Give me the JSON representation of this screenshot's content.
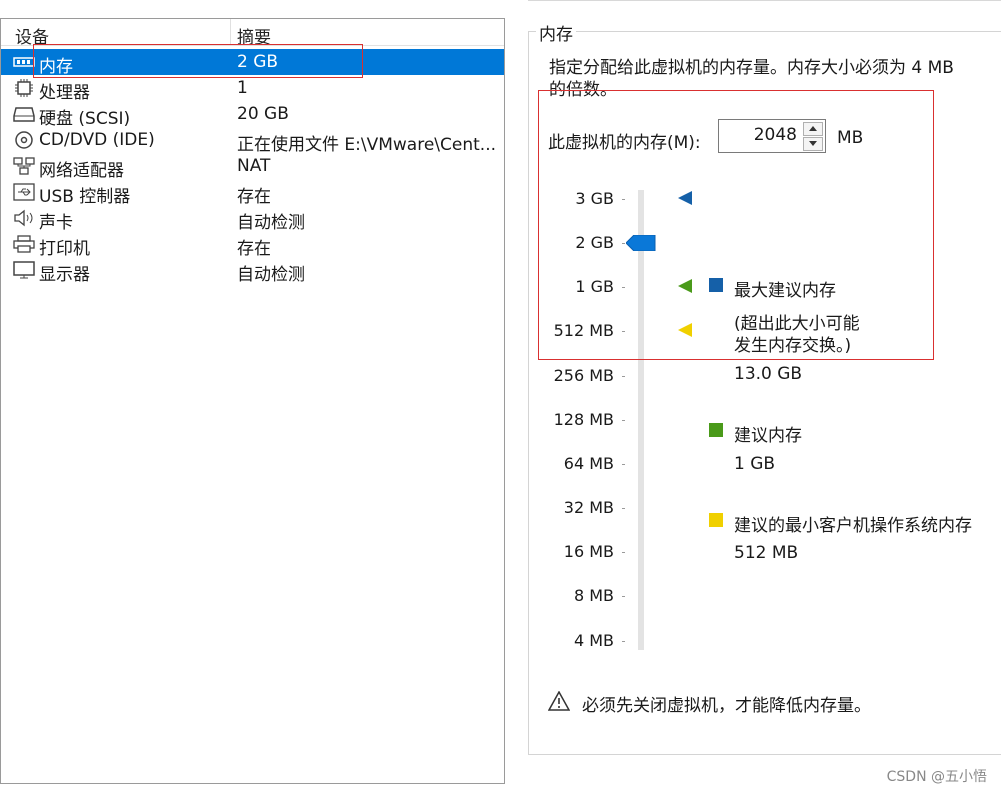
{
  "table": {
    "col_device": "设备",
    "col_summary": "摘要"
  },
  "devices": [
    {
      "name": "内存",
      "summary": "2 GB",
      "icon": "memory-icon"
    },
    {
      "name": "处理器",
      "summary": "1",
      "icon": "processor-icon"
    },
    {
      "name": "硬盘 (SCSI)",
      "summary": "20 GB",
      "icon": "harddisk-icon"
    },
    {
      "name": "CD/DVD (IDE)",
      "summary": "正在使用文件 E:\\VMware\\Cent...",
      "icon": "cd-dvd-icon"
    },
    {
      "name": "网络适配器",
      "summary": "NAT",
      "icon": "network-adapter-icon"
    },
    {
      "name": "USB 控制器",
      "summary": "存在",
      "icon": "usb-icon"
    },
    {
      "name": "声卡",
      "summary": "自动检测",
      "icon": "sound-card-icon"
    },
    {
      "name": "打印机",
      "summary": "存在",
      "icon": "printer-icon"
    },
    {
      "name": "显示器",
      "summary": "自动检测",
      "icon": "monitor-icon"
    }
  ],
  "memory": {
    "group_title": "内存",
    "description_line1": "指定分配给此虚拟机的内存量。内存大小必须为 4 MB",
    "description_line2": "的倍数。",
    "field_label": "此虚拟机的内存(M):",
    "field_value": "2048",
    "field_unit": "MB",
    "scale_labels": [
      "3 GB",
      "2 GB",
      "1 GB",
      "512 MB",
      "256 MB",
      "128 MB",
      "64 MB",
      "32 MB",
      "16 MB",
      "8 MB",
      "4 MB"
    ],
    "slider_value": "2 GB",
    "max_recommended_label": "最大建议内存",
    "max_recommended_note_line1": "(超出此大小可能",
    "max_recommended_note_line2": "发生内存交换。)",
    "max_recommended_value": "13.0 GB",
    "recommended_label": "建议内存",
    "recommended_value": "1 GB",
    "min_guest_label": "建议的最小客户机操作系统内存",
    "min_guest_value": "512 MB",
    "warning_text": "必须先关闭虚拟机，才能降低内存量。"
  },
  "colors": {
    "selection": "#0078d7",
    "max_marker": "#1560a8",
    "recommended_marker": "#4a9a1a",
    "min_marker": "#f0d000",
    "annotation_box": "#d93030"
  },
  "watermark": "CSDN @五小悟"
}
